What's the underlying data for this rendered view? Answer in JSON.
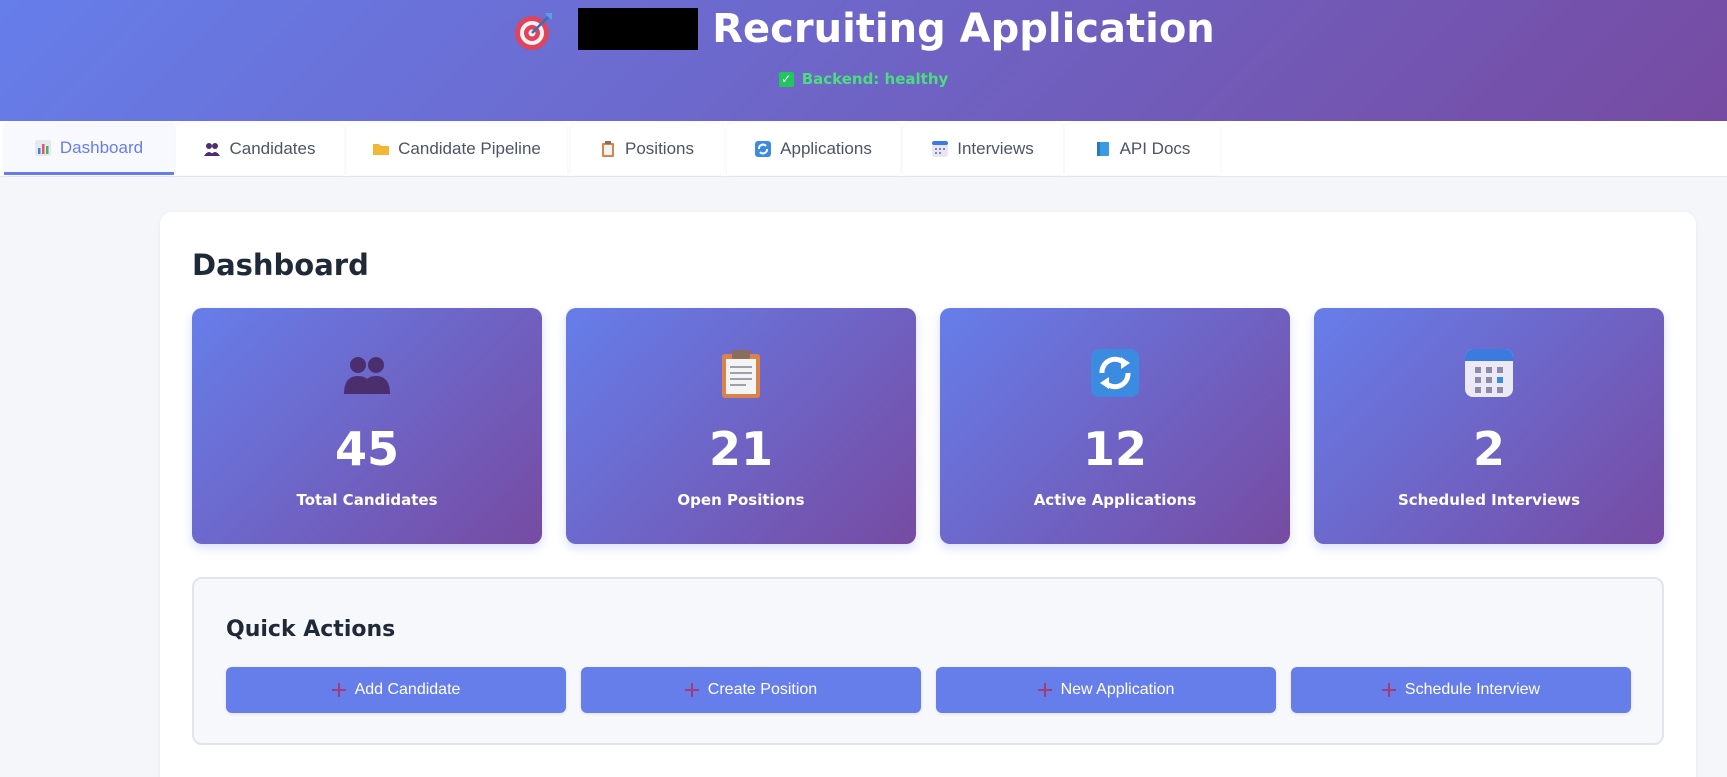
{
  "header": {
    "title": "Recruiting Application",
    "icon": "target-dart-icon",
    "backend_status": "Backend: healthy",
    "brand_gradient": [
      "#667eea",
      "#764ba2"
    ]
  },
  "tabs": [
    {
      "label": "Dashboard",
      "icon": "bar-chart-icon",
      "active": true
    },
    {
      "label": "Candidates",
      "icon": "people-icon"
    },
    {
      "label": "Candidate Pipeline",
      "icon": "folder-icon"
    },
    {
      "label": "Positions",
      "icon": "clipboard-icon"
    },
    {
      "label": "Applications",
      "icon": "refresh-icon"
    },
    {
      "label": "Interviews",
      "icon": "calendar-icon"
    },
    {
      "label": "API Docs",
      "icon": "book-icon"
    }
  ],
  "dashboard": {
    "title": "Dashboard",
    "stats": [
      {
        "value": "45",
        "label": "Total Candidates",
        "icon": "people-icon"
      },
      {
        "value": "21",
        "label": "Open Positions",
        "icon": "clipboard-icon"
      },
      {
        "value": "12",
        "label": "Active Applications",
        "icon": "refresh-icon"
      },
      {
        "value": "2",
        "label": "Scheduled Interviews",
        "icon": "calendar-icon"
      }
    ]
  },
  "quick_actions": {
    "title": "Quick Actions",
    "buttons": [
      {
        "label": "Add Candidate",
        "icon": "plus-icon"
      },
      {
        "label": "Create Position",
        "icon": "plus-icon"
      },
      {
        "label": "New Application",
        "icon": "plus-icon"
      },
      {
        "label": "Schedule Interview",
        "icon": "plus-icon"
      }
    ]
  }
}
